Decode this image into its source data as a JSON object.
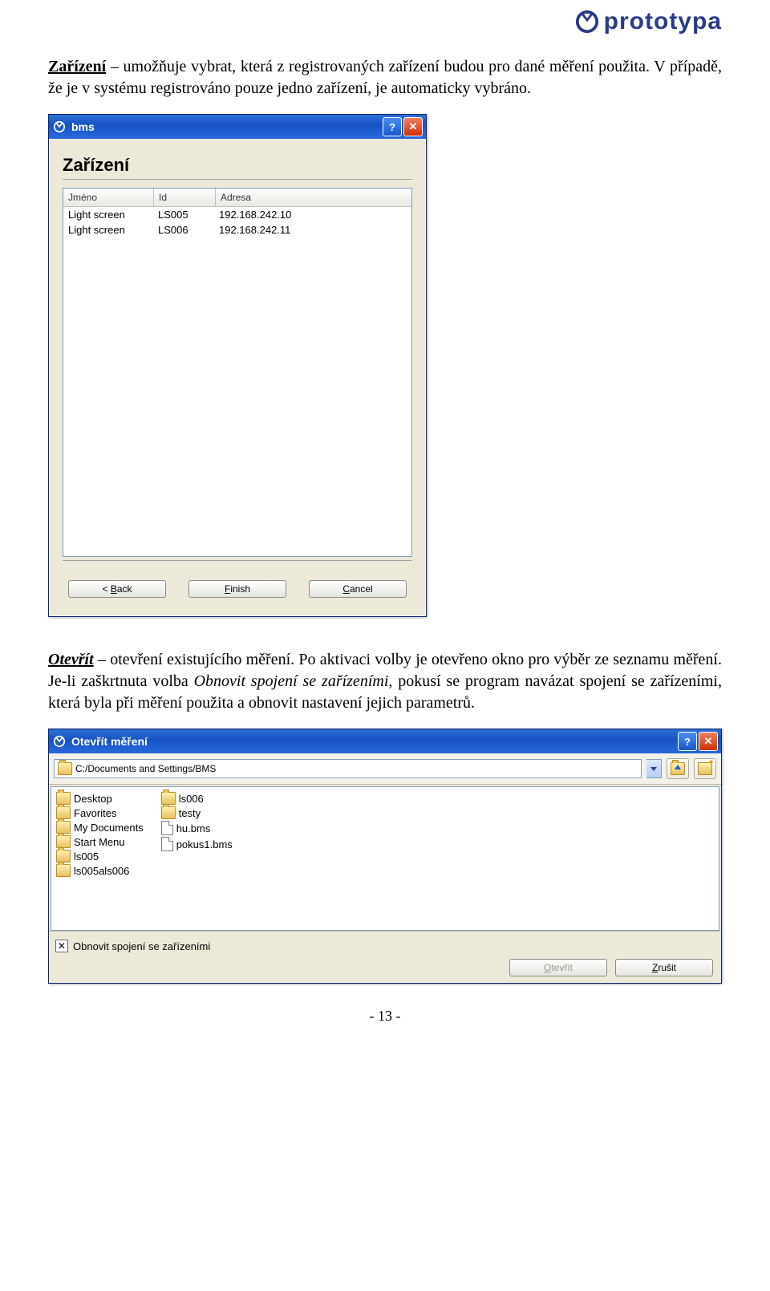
{
  "brand": {
    "name": "prototypa"
  },
  "para1": {
    "lead": "Zařízení",
    "rest": " – umožňuje vybrat, která z registrovaných zařízení budou pro dané měření použita. V případě, že je v systému registrováno pouze jedno zařízení, je automaticky vybráno."
  },
  "bms": {
    "title": "bms",
    "heading": "Zařízení",
    "cols": {
      "name": "Jméno",
      "id": "Id",
      "addr": "Adresa"
    },
    "rows": [
      {
        "name": "Light screen",
        "id": "LS005",
        "addr": "192.168.242.10"
      },
      {
        "name": "Light screen",
        "id": "LS006",
        "addr": "192.168.242.11"
      }
    ],
    "buttons": {
      "back_pre": "< ",
      "back_u": "B",
      "back_post": "ack",
      "finish_u": "F",
      "finish_post": "inish",
      "cancel_u": "C",
      "cancel_post": "ancel"
    }
  },
  "para2": {
    "lead": "Otevřít",
    "mid1": " – otevření existujícího měření. Po aktivaci volby je otevřeno okno pro výběr ze seznamu měření. Je-li zaškrtnuta volba ",
    "ital": "Obnovit spojení se zařízeními",
    "mid2": ", pokusí se program navázat spojení se zařízeními, která byla při měření použita a obnovit nastavení jejich parametrů."
  },
  "open": {
    "title": "Otevřít měření",
    "path": "C:/Documents and Settings/BMS",
    "col1": [
      {
        "type": "folder",
        "label": "Desktop"
      },
      {
        "type": "folder",
        "label": "Favorites"
      },
      {
        "type": "folder",
        "label": "My Documents"
      },
      {
        "type": "folder",
        "label": "Start Menu"
      },
      {
        "type": "folder",
        "label": "ls005"
      },
      {
        "type": "folder",
        "label": "ls005als006"
      }
    ],
    "col2": [
      {
        "type": "folder",
        "label": "ls006"
      },
      {
        "type": "folder",
        "label": "testy"
      },
      {
        "type": "file",
        "label": "hu.bms"
      },
      {
        "type": "file",
        "label": "pokus1.bms"
      }
    ],
    "checkbox": {
      "checked": true,
      "label": "Obnovit spojení se zařízeními"
    },
    "buttons": {
      "open_u": "O",
      "open_post": "tevřít",
      "cancel_u": "Z",
      "cancel_post": "rušit"
    }
  },
  "pagenum": "- 13 -"
}
